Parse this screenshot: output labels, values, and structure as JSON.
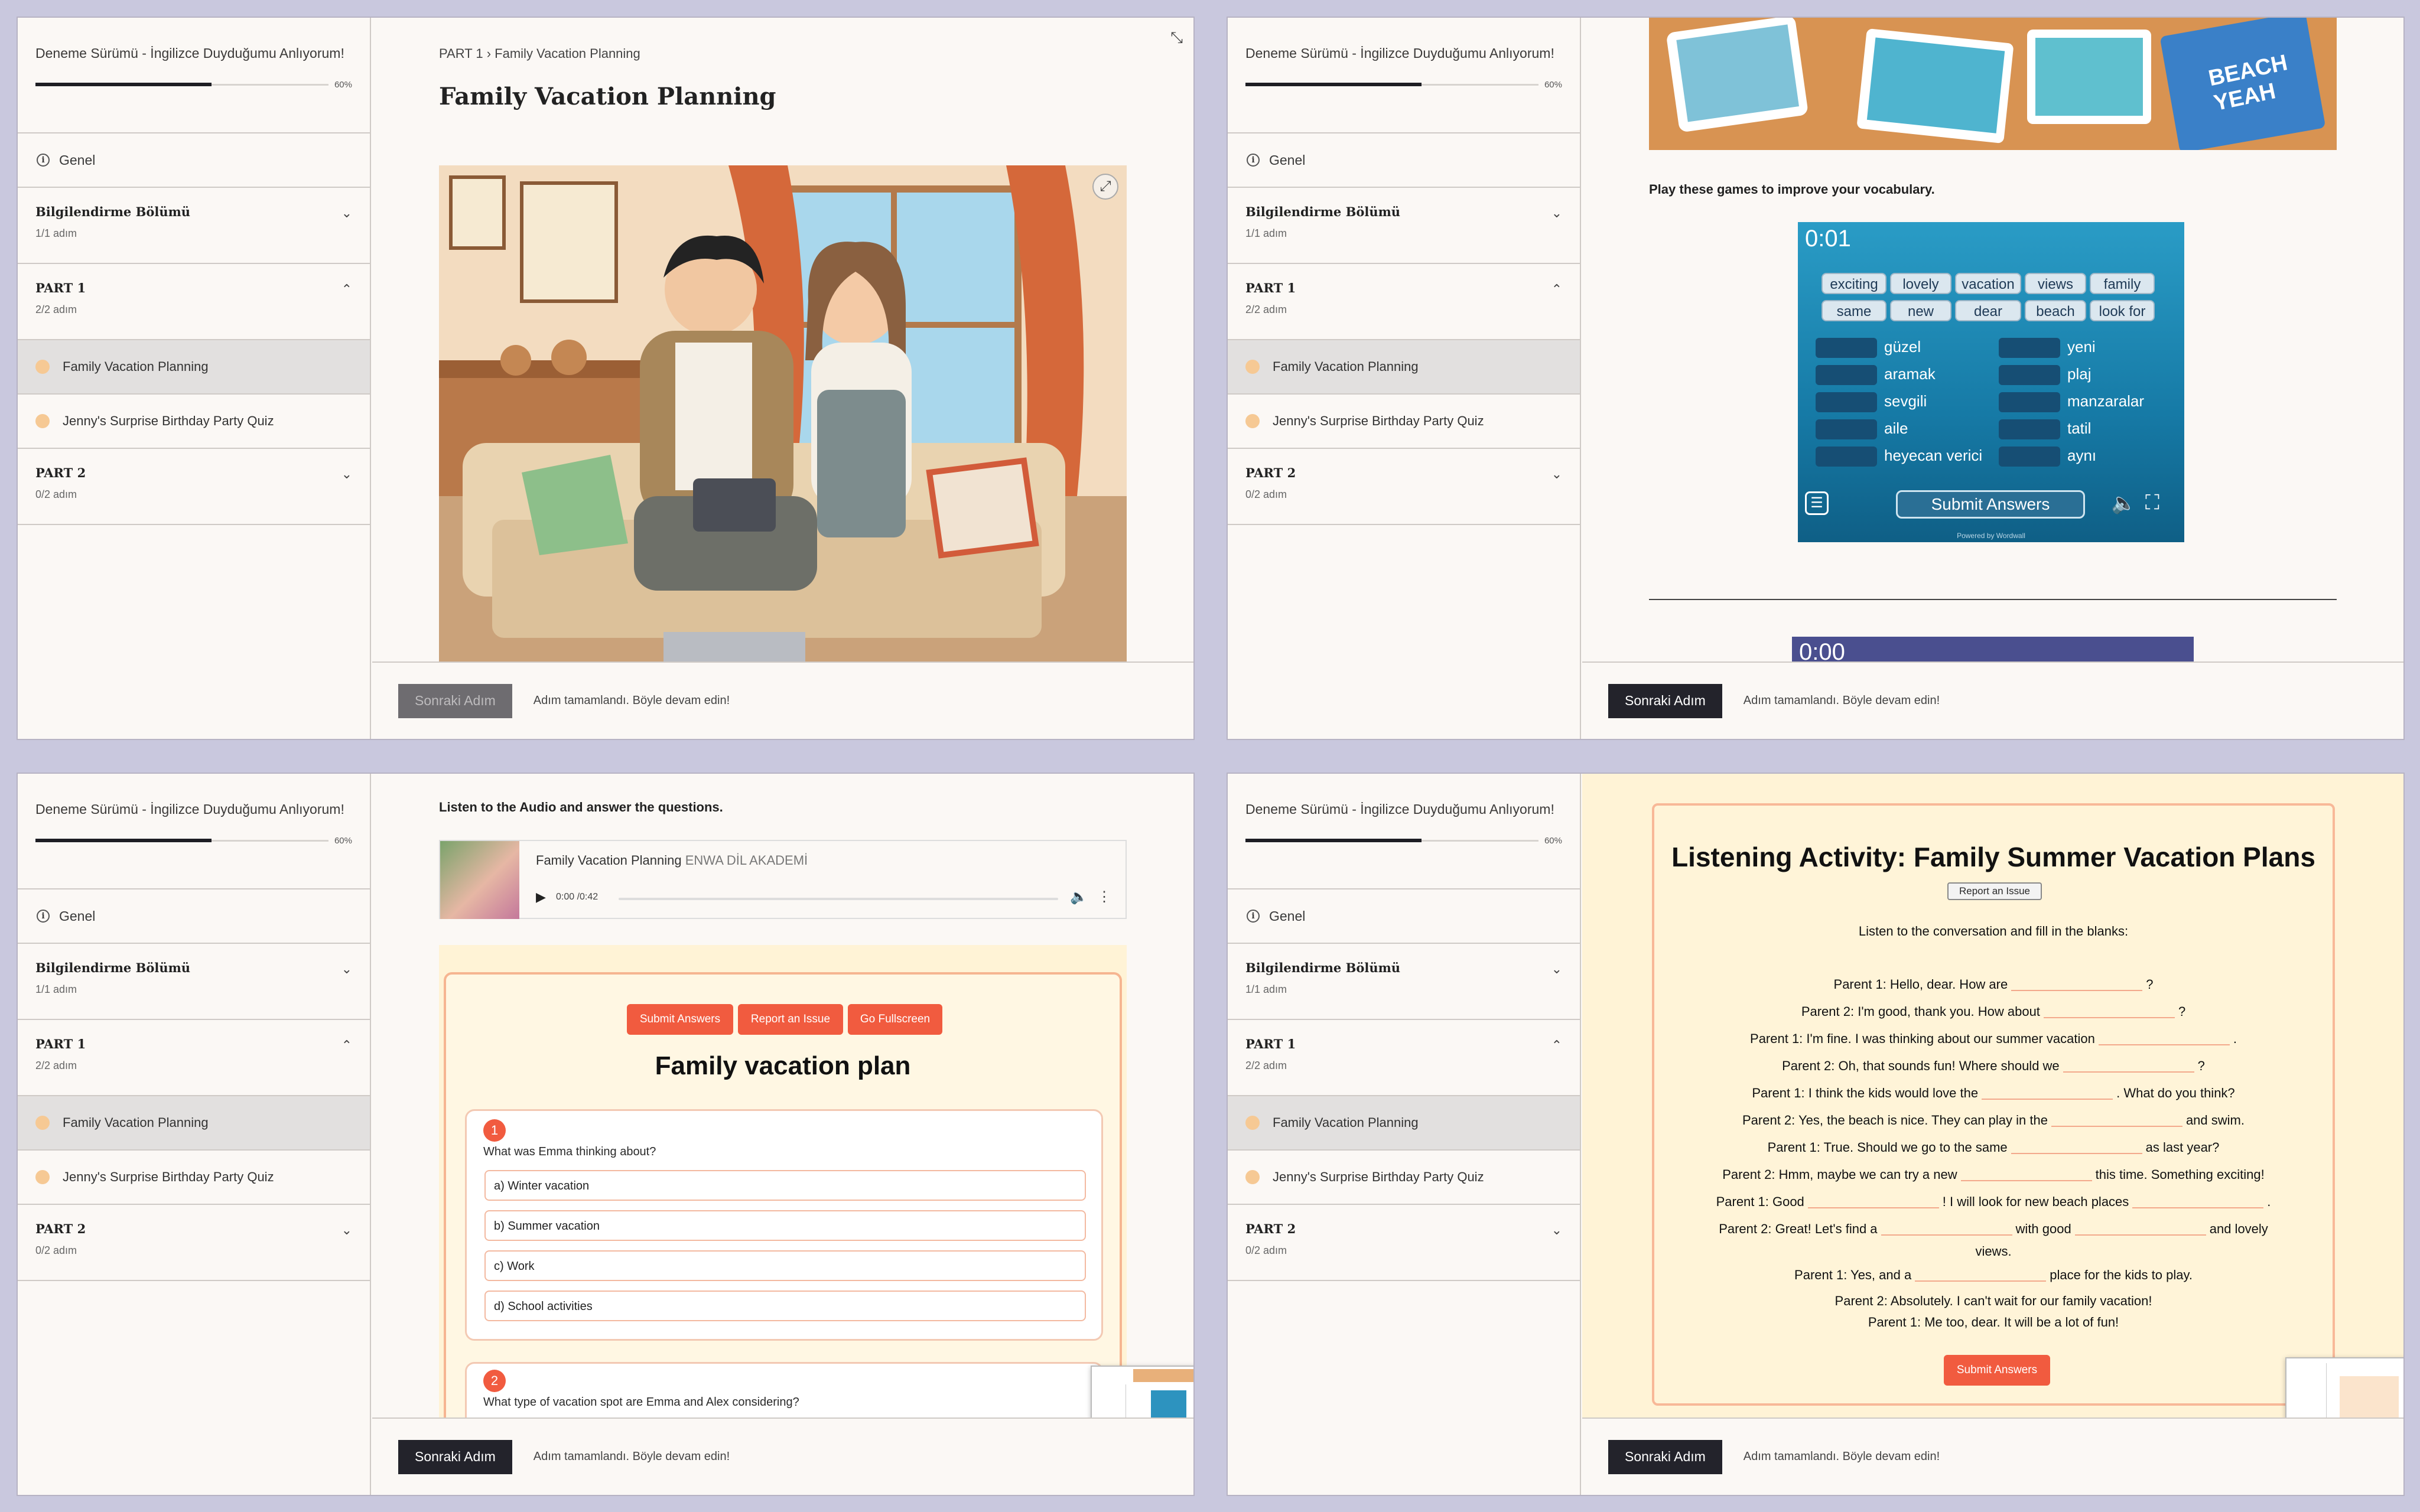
{
  "course": {
    "title": "Deneme Sürümü - İngilizce Duyduğumu Anlıyorum!",
    "progress_label": "60%",
    "progress": 0.6
  },
  "sidebar": {
    "general": "Genel",
    "sections": [
      {
        "title": "Bilgilendirme Bölümü",
        "sub": "1/1 adım",
        "chevron": "chevron-down-icon"
      },
      {
        "title": "PART 1",
        "sub": "2/2 adım",
        "chevron": "chevron-up-icon"
      },
      {
        "title": "PART 2",
        "sub": "0/2 adım",
        "chevron": "chevron-down-icon"
      }
    ],
    "steps": [
      "Family Vacation Planning",
      "Jenny's Surprise Birthday Party Quiz"
    ]
  },
  "footer": {
    "next_label": "Sonraki Adım",
    "message": "Adım tamamlandı. Böyle devam edin!"
  },
  "panel1": {
    "breadcrumb_part": "PART 1",
    "breadcrumb_sep": "›",
    "breadcrumb_page": "Family Vacation Planning",
    "page_title": "Family Vacation Planning"
  },
  "panel2": {
    "instruction": "Play these games to improve your vocabulary.",
    "timer": "0:01",
    "timer2": "0:00",
    "word_bank": [
      "exciting",
      "lovely",
      "vacation",
      "views",
      "family",
      "same",
      "new",
      "dear",
      "beach",
      "look for"
    ],
    "targets_left": [
      "güzel",
      "aramak",
      "sevgili",
      "aile",
      "heyecan verici"
    ],
    "targets_right": [
      "yeni",
      "plaj",
      "manzaralar",
      "tatil",
      "aynı"
    ],
    "submit_label": "Submit Answers",
    "powered": "Powered by Wordwall",
    "beach_book": "BEACH YEAH"
  },
  "panel3": {
    "instruction": "Listen to the Audio and answer the questions.",
    "audio_title": "Family Vacation Planning",
    "audio_channel": "ENWA DİL AKADEMİ",
    "audio_time": "0:00 /0:42",
    "buttons": [
      "Submit Answers",
      "Report an Issue",
      "Go Fullscreen"
    ],
    "quiz_title": "Family vacation plan",
    "q1": {
      "num": "1",
      "text": "What was Emma thinking about?",
      "options": [
        "a) Winter vacation",
        "b) Summer vacation",
        "c) Work",
        "d) School activities"
      ]
    },
    "q2": {
      "num": "2",
      "text": "What type of vacation spot are Emma and Alex considering?"
    }
  },
  "panel4": {
    "title": "Listening Activity: Family Summer Vacation Plans",
    "report_label": "Report an Issue",
    "instruction": "Listen to the conversation and fill in the blanks:",
    "lines": [
      [
        "Parent 1: Hello, dear. How are",
        "?"
      ],
      [
        "Parent 2: I'm good, thank you. How about",
        "?"
      ],
      [
        "Parent 1: I'm fine. I was thinking about our summer vacation",
        "."
      ],
      [
        "Parent 2: Oh, that sounds fun! Where should we",
        "?"
      ],
      [
        "Parent 1: I think the kids would love the",
        ". What do you think?"
      ],
      [
        "Parent 2: Yes, the beach is nice. They can play in the",
        "and swim."
      ],
      [
        "Parent 1: True. Should we go to the same",
        "as last year?"
      ],
      [
        "Parent 2: Hmm, maybe we can try a new",
        "this time. Something exciting!"
      ],
      [
        "Parent 1: Good",
        "! I will look for new beach places",
        "."
      ],
      [
        "Parent 2: Great! Let's find a",
        "with good",
        "and lovely"
      ],
      [
        "views."
      ],
      [
        "Parent 1: Yes, and a",
        "place for the kids to play."
      ],
      [
        "Parent 2: Absolutely. I can't wait for our family vacation!"
      ],
      [
        "Parent 1: Me too, dear. It will be a lot of fun!"
      ]
    ],
    "submit_label": "Submit Answers"
  }
}
